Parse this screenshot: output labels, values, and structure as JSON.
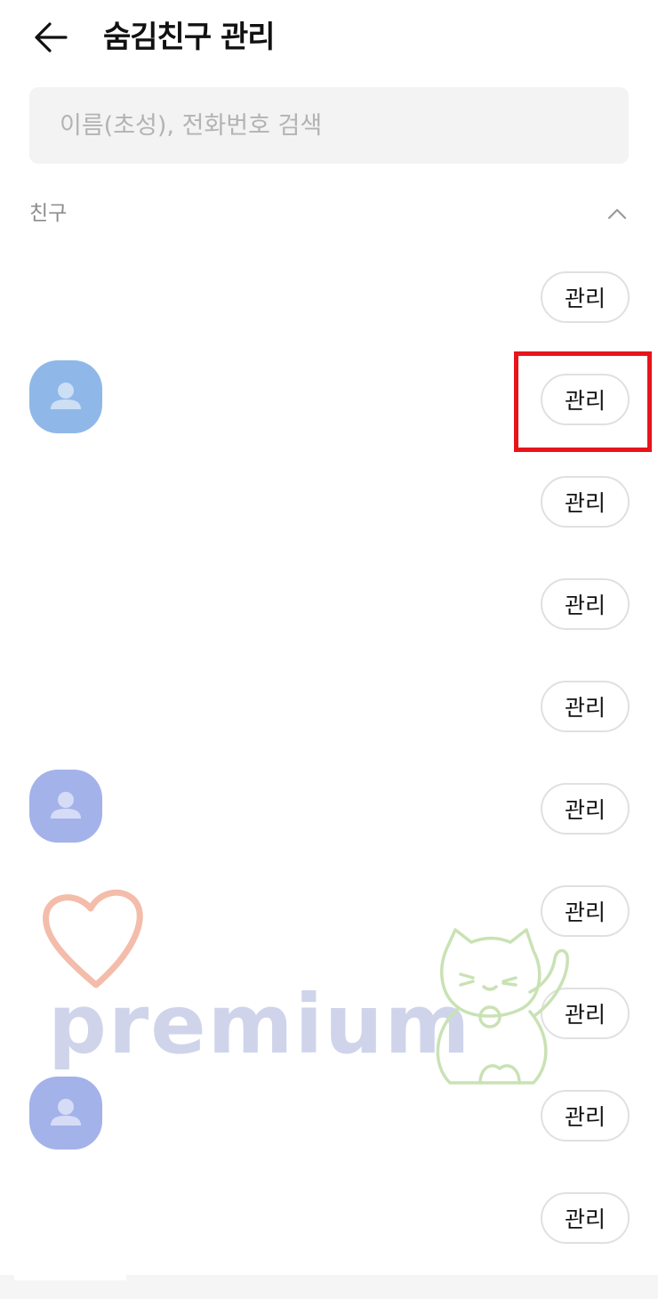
{
  "header": {
    "title": "숨김친구 관리"
  },
  "search": {
    "placeholder": "이름(초성), 전화번호 검색",
    "value": ""
  },
  "section": {
    "label": "친구",
    "state": "expanded"
  },
  "friends": [
    {
      "avatar": "",
      "button_label": "관리"
    },
    {
      "avatar": "person-icon",
      "button_label": "관리"
    },
    {
      "avatar": "",
      "button_label": "관리"
    },
    {
      "avatar": "",
      "button_label": "관리"
    },
    {
      "avatar": "",
      "button_label": "관리"
    },
    {
      "avatar": "person-icon",
      "button_label": "관리"
    },
    {
      "avatar": "",
      "button_label": "관리"
    },
    {
      "avatar": "",
      "button_label": "관리"
    },
    {
      "avatar": "person-icon",
      "button_label": "관리"
    },
    {
      "avatar": "",
      "button_label": "관리"
    }
  ],
  "watermark": {
    "text": "premium"
  },
  "colors": {
    "highlight": "#e8141b",
    "avatar_blue": "#8fb8e8",
    "avatar_purple": "#a4b2ea",
    "search_bg": "#f3f3f3"
  }
}
